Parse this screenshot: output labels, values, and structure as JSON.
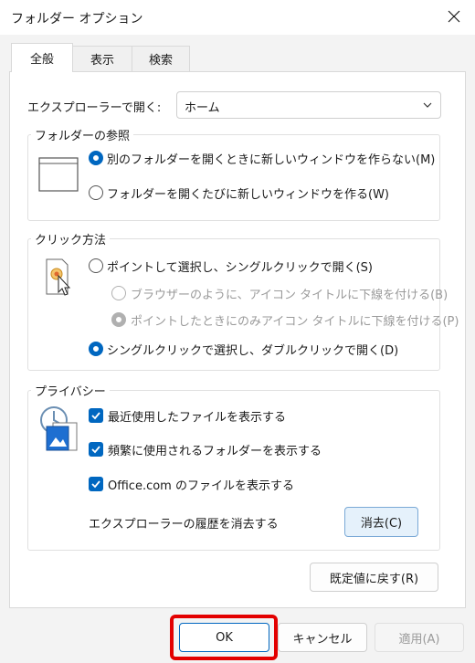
{
  "window": {
    "title": "フォルダー オプション",
    "close_icon": "close-icon"
  },
  "tabs": [
    {
      "label": "全般",
      "active": true
    },
    {
      "label": "表示",
      "active": false
    },
    {
      "label": "検索",
      "active": false
    }
  ],
  "open_explorer": {
    "label": "エクスプローラーで開く:",
    "value": "ホーム"
  },
  "browse_folders": {
    "legend": "フォルダーの参照",
    "options": [
      {
        "label": "別のフォルダーを開くときに新しいウィンドウを作らない(M)",
        "checked": true
      },
      {
        "label": "フォルダーを開くたびに新しいウィンドウを作る(W)",
        "checked": false
      }
    ]
  },
  "click_method": {
    "legend": "クリック方法",
    "options": [
      {
        "label": "ポイントして選択し、シングルクリックで開く(S)",
        "checked": false,
        "enabled": true
      },
      {
        "label": "ブラウザーのように、アイコン タイトルに下線を付ける(B)",
        "checked": false,
        "enabled": false
      },
      {
        "label": "ポイントしたときにのみアイコン タイトルに下線を付ける(P)",
        "checked": true,
        "enabled": false
      },
      {
        "label": "シングルクリックで選択し、ダブルクリックで開く(D)",
        "checked": true,
        "enabled": true
      }
    ]
  },
  "privacy": {
    "legend": "プライバシー",
    "checkboxes": [
      {
        "label": "最近使用したファイルを表示する",
        "checked": true
      },
      {
        "label": "頻繁に使用されるフォルダーを表示する",
        "checked": true
      },
      {
        "label": "Office.com のファイルを表示する",
        "checked": true
      }
    ],
    "clear_label": "エクスプローラーの履歴を消去する",
    "clear_button": "消去(C)"
  },
  "restore_defaults": "既定値に戻す(R)",
  "footer": {
    "ok": "OK",
    "cancel": "キャンセル",
    "apply": "適用(A)"
  },
  "colors": {
    "accent": "#0067c0",
    "highlight": "#e30000"
  }
}
